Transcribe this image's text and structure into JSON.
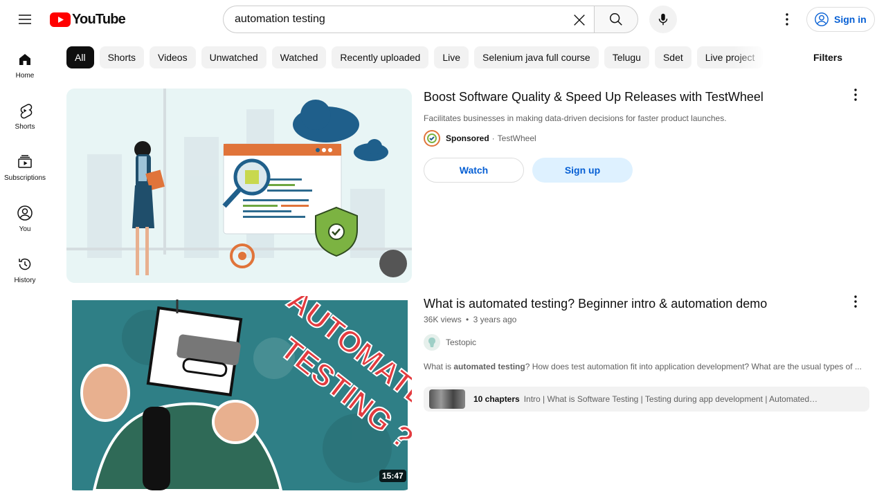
{
  "header": {
    "logo_text": "YouTube",
    "search_value": "automation testing",
    "signin_label": "Sign in"
  },
  "sidebar": {
    "items": [
      {
        "label": "Home",
        "icon": "home-icon"
      },
      {
        "label": "Shorts",
        "icon": "shorts-icon"
      },
      {
        "label": "Subscriptions",
        "icon": "subscriptions-icon"
      },
      {
        "label": "You",
        "icon": "you-icon"
      },
      {
        "label": "History",
        "icon": "history-icon"
      }
    ]
  },
  "chips": [
    "All",
    "Shorts",
    "Videos",
    "Unwatched",
    "Watched",
    "Recently uploaded",
    "Live",
    "Selenium java full course",
    "Telugu",
    "Sdet",
    "Live project"
  ],
  "filters_label": "Filters",
  "results": [
    {
      "title": "Boost Software Quality & Speed Up Releases with TestWheel",
      "description": "Facilitates businesses in making data-driven decisions for faster product launches.",
      "sponsored_label": "Sponsored",
      "separator": "·",
      "channel": "TestWheel",
      "watch_label": "Watch",
      "signup_label": "Sign up"
    },
    {
      "title": "What is automated testing? Beginner intro & automation demo",
      "views": "36K views",
      "separator": "•",
      "age": "3 years ago",
      "channel": "Testopic",
      "snippet_pre": "What is ",
      "snippet_bold": "automated testing",
      "snippet_post": "? How does test automation fit into application development? What are the usual types of ...",
      "chapters_count": "10 chapters",
      "chapters_list": "Intro | What is Software Testing | Testing during app development | Automated…",
      "duration": "15:47",
      "thumb_text_line1": "AUTOMATED",
      "thumb_text_line2": "TESTING ?"
    }
  ],
  "colors": {
    "brand_red": "#ff0000",
    "link_blue": "#065fd4",
    "chip_bg": "#f2f2f2"
  }
}
